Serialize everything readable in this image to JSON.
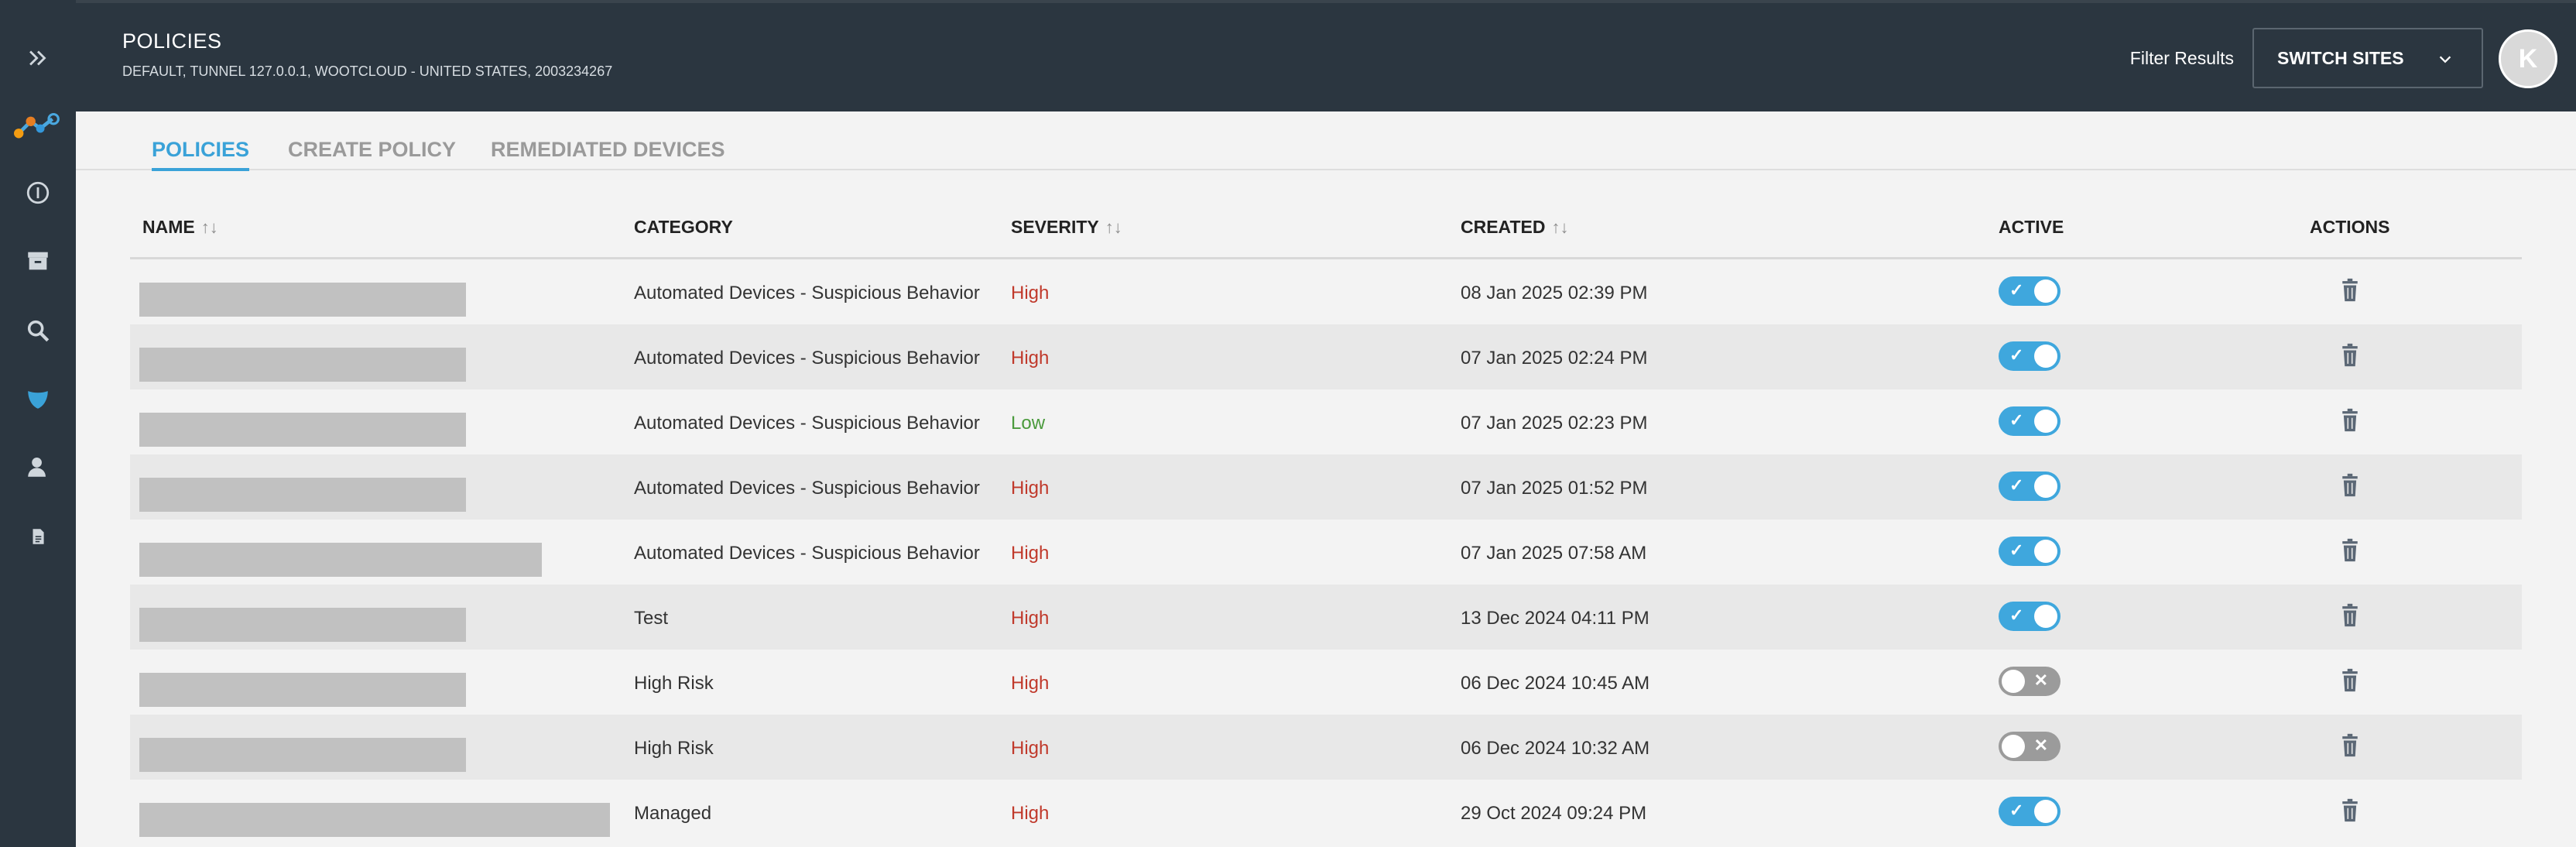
{
  "header": {
    "title": "POLICIES",
    "subtitle": "DEFAULT, TUNNEL 127.0.0.1, WOOTCLOUD - UNITED STATES, 2003234267",
    "filter_label": "Filter Results",
    "switch_sites_label": "SWITCH SITES",
    "avatar_initial": "K"
  },
  "sidebar": {
    "items": [
      {
        "icon": "double-chevron-right-icon"
      },
      {
        "icon": "logo-icon"
      },
      {
        "icon": "info-icon"
      },
      {
        "icon": "archive-icon"
      },
      {
        "icon": "search-icon"
      },
      {
        "icon": "shield-icon"
      },
      {
        "icon": "user-icon"
      },
      {
        "icon": "document-icon"
      }
    ]
  },
  "tabs": [
    {
      "label": "POLICIES",
      "active": true
    },
    {
      "label": "CREATE POLICY",
      "active": false
    },
    {
      "label": "REMEDIATED DEVICES",
      "active": false
    }
  ],
  "table": {
    "columns": {
      "name": "NAME",
      "category": "CATEGORY",
      "severity": "SEVERITY",
      "created": "CREATED",
      "active": "ACTIVE",
      "actions": "ACTIONS"
    },
    "sort_arrows": "↑↓",
    "rows": [
      {
        "category": "Automated Devices - Suspicious Behavior",
        "severity": "High",
        "created": "08 Jan 2025 02:39 PM",
        "active": true
      },
      {
        "category": "Automated Devices - Suspicious Behavior",
        "severity": "High",
        "created": "07 Jan 2025 02:24 PM",
        "active": true
      },
      {
        "category": "Automated Devices - Suspicious Behavior",
        "severity": "Low",
        "created": "07 Jan 2025 02:23 PM",
        "active": true
      },
      {
        "category": "Automated Devices - Suspicious Behavior",
        "severity": "High",
        "created": "07 Jan 2025 01:52 PM",
        "active": true
      },
      {
        "category": "Automated Devices - Suspicious Behavior",
        "severity": "High",
        "created": "07 Jan 2025 07:58 AM",
        "active": true
      },
      {
        "category": "Test",
        "severity": "High",
        "created": "13 Dec 2024 04:11 PM",
        "active": true
      },
      {
        "category": "High Risk",
        "severity": "High",
        "created": "06 Dec 2024 10:45 AM",
        "active": false
      },
      {
        "category": "High Risk",
        "severity": "High",
        "created": "06 Dec 2024 10:32 AM",
        "active": false
      },
      {
        "category": "Managed",
        "severity": "High",
        "created": "29 Oct 2024 09:24 PM",
        "active": true
      }
    ]
  },
  "colors": {
    "header_bg": "#2b3640",
    "accent": "#3aa2d8",
    "severity_high": "#c0392b",
    "severity_low": "#4a9a3c"
  }
}
